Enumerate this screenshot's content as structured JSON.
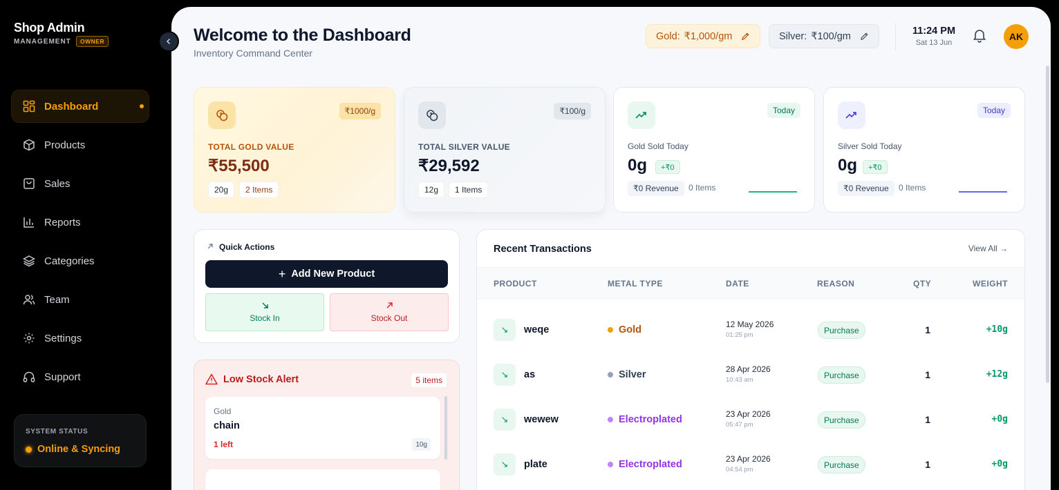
{
  "sidebar": {
    "brand": "Shop Admin",
    "brand_sub": "MANAGEMENT",
    "role_badge": "OWNER",
    "items": [
      {
        "label": "Dashboard"
      },
      {
        "label": "Products"
      },
      {
        "label": "Sales"
      },
      {
        "label": "Reports"
      },
      {
        "label": "Categories"
      },
      {
        "label": "Team"
      },
      {
        "label": "Settings"
      },
      {
        "label": "Support"
      }
    ],
    "system_status_label": "SYSTEM STATUS",
    "system_status_value": "Online & Syncing"
  },
  "header": {
    "title": "Welcome to the Dashboard",
    "subtitle": "Inventory Command Center",
    "gold_label": "Gold:",
    "gold_price": "₹1,000/gm",
    "silver_label": "Silver:",
    "silver_price": "₹100/gm",
    "time": "11:24 PM",
    "date": "Sat 13 Jun",
    "avatar_initials": "AK"
  },
  "stats": {
    "gold": {
      "rate": "₹1000/g",
      "label": "TOTAL GOLD VALUE",
      "value": "₹55,500",
      "weight": "20g",
      "items": "2 Items"
    },
    "silver": {
      "rate": "₹100/g",
      "label": "TOTAL SILVER VALUE",
      "value": "₹29,592",
      "weight": "12g",
      "items": "1 Items"
    },
    "gold_today": {
      "badge": "Today",
      "label": "Gold Sold Today",
      "value": "0g",
      "delta": "+₹0",
      "revenue": "₹0 Revenue",
      "items": "0 Items"
    },
    "silver_today": {
      "badge": "Today",
      "label": "Silver Sold Today",
      "value": "0g",
      "delta": "+₹0",
      "revenue": "₹0 Revenue",
      "items": "0 Items"
    }
  },
  "quick_actions": {
    "title": "Quick Actions",
    "add_product": "Add New Product",
    "stock_in": "Stock In",
    "stock_out": "Stock Out"
  },
  "low_stock": {
    "title": "Low Stock Alert",
    "count": "5 items",
    "items": [
      {
        "metal": "Gold",
        "name": "chain",
        "left": "1 left",
        "weight": "10g"
      }
    ]
  },
  "transactions": {
    "title": "Recent Transactions",
    "view_all": "View All",
    "columns": [
      "PRODUCT",
      "METAL TYPE",
      "DATE",
      "REASON",
      "QTY",
      "WEIGHT"
    ],
    "rows": [
      {
        "product": "weqe",
        "metal": "Gold",
        "date": "12 May 2026",
        "time": "01:25 pm",
        "reason": "Purchase",
        "qty": "1",
        "weight": "+10g"
      },
      {
        "product": "as",
        "metal": "Silver",
        "date": "28 Apr 2026",
        "time": "10:43 am",
        "reason": "Purchase",
        "qty": "1",
        "weight": "+12g"
      },
      {
        "product": "wewew",
        "metal": "Electroplated",
        "date": "23 Apr 2026",
        "time": "05:47 pm",
        "reason": "Purchase",
        "qty": "1",
        "weight": "+0g"
      },
      {
        "product": "plate",
        "metal": "Electroplated",
        "date": "23 Apr 2026",
        "time": "04:54 pm",
        "reason": "Purchase",
        "qty": "1",
        "weight": "+0g"
      }
    ]
  },
  "colors": {
    "accent": "#f59e0b",
    "gold_text": "#b45309",
    "silver_dot": "#94a3b8",
    "electroplated": "#9333ea",
    "success": "#059669",
    "danger": "#dc2626"
  }
}
